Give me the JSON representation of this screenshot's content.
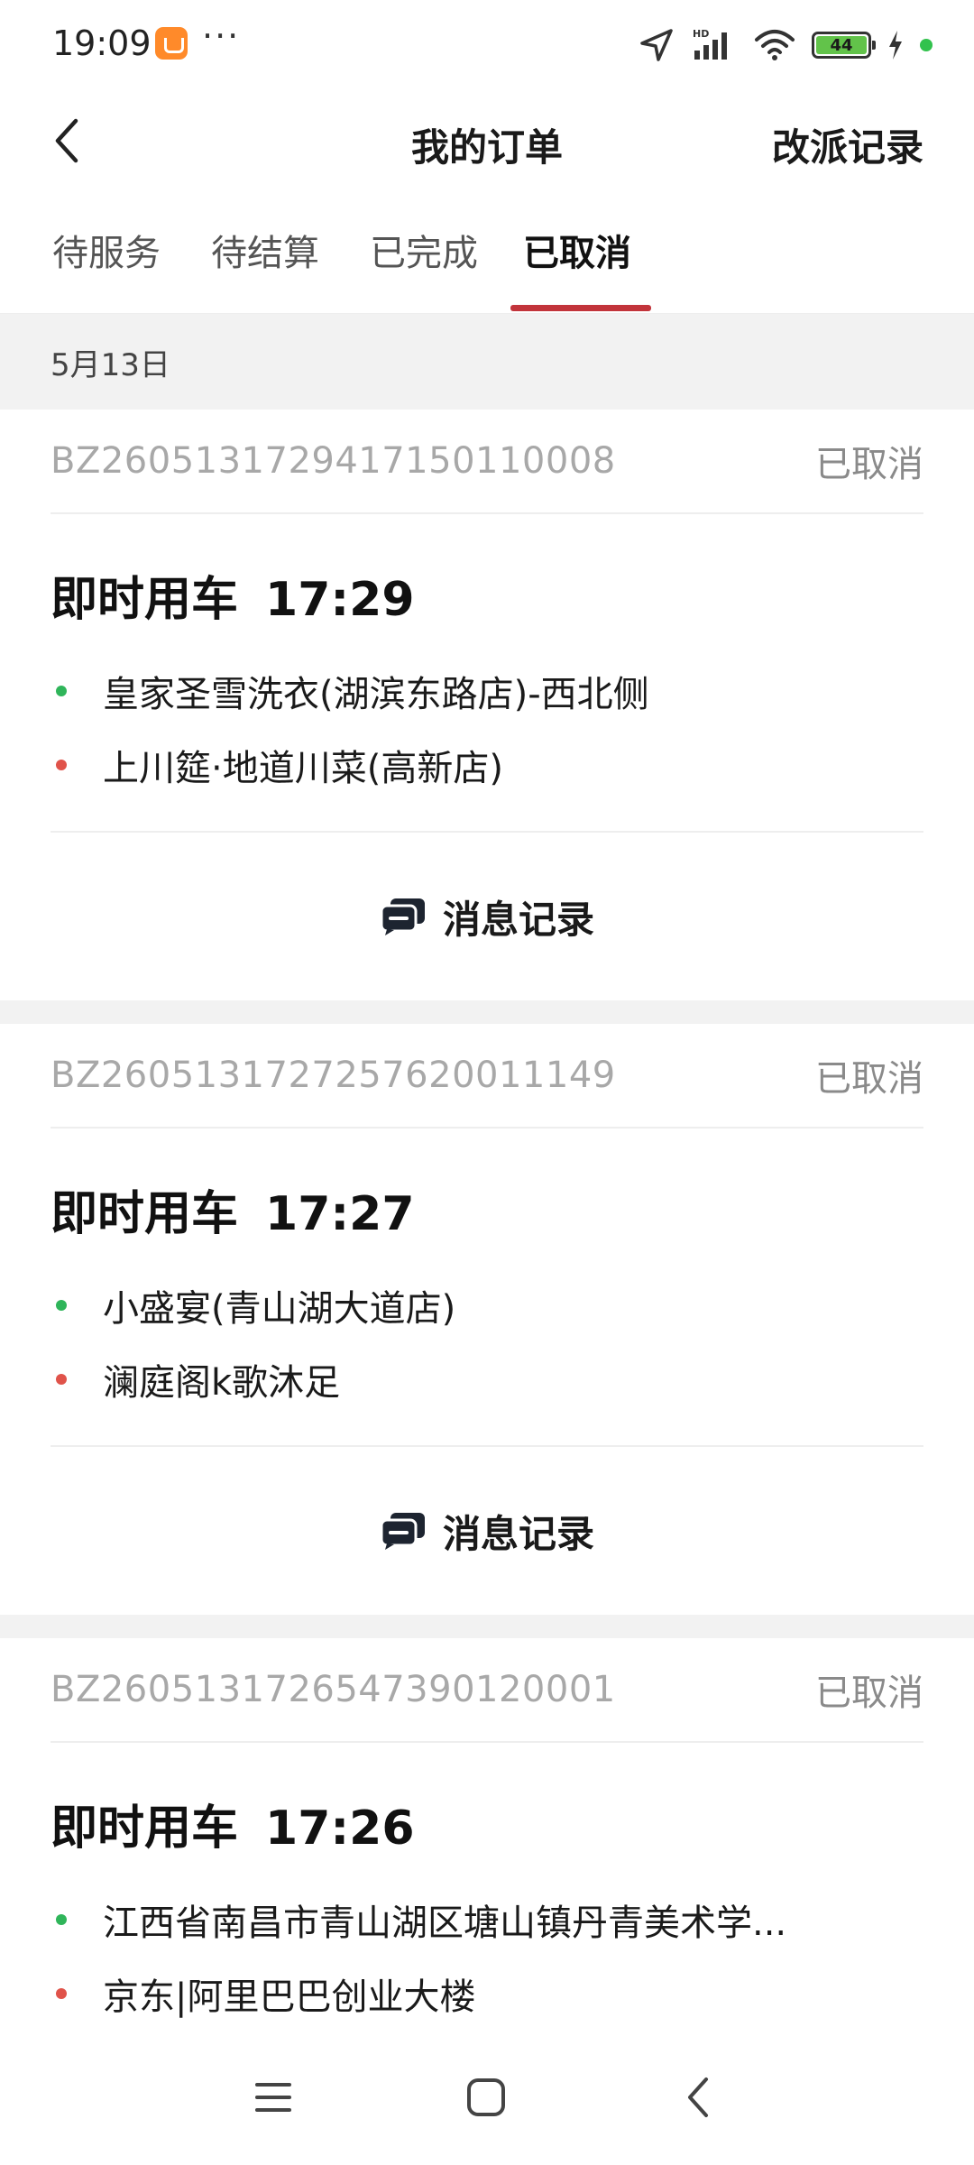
{
  "status_bar": {
    "time": "19:09",
    "battery": "44",
    "more": "···"
  },
  "header": {
    "title": "我的订单",
    "right_action": "改派记录"
  },
  "tabs": [
    {
      "label": "待服务",
      "active": false
    },
    {
      "label": "待结算",
      "active": false
    },
    {
      "label": "已完成",
      "active": false
    },
    {
      "label": "已取消",
      "active": true
    }
  ],
  "date_group": "5月13日",
  "orders": [
    {
      "order_no": "BZ2605131729417150110008",
      "status": "已取消",
      "type": "即时用车",
      "time": "17:29",
      "start": "皇家圣雪洗衣(湖滨东路店)-西北侧",
      "end": "上川筵·地道川菜(高新店)",
      "footer_label": "消息记录"
    },
    {
      "order_no": "BZ2605131727257620011149",
      "status": "已取消",
      "type": "即时用车",
      "time": "17:27",
      "start": "小盛宴(青山湖大道店)",
      "end": "澜庭阁k歌沐足",
      "footer_label": "消息记录"
    },
    {
      "order_no": "BZ2605131726547390120001",
      "status": "已取消",
      "type": "即时用车",
      "time": "17:26",
      "start": "江西省南昌市青山湖区塘山镇丹青美术学...",
      "end": "京东|阿里巴巴创业大楼",
      "footer_label": ""
    }
  ],
  "colors": {
    "accent": "#c2343b",
    "start_dot": "#2fb55a",
    "end_dot": "#e0534a",
    "battery": "#62c34a"
  }
}
